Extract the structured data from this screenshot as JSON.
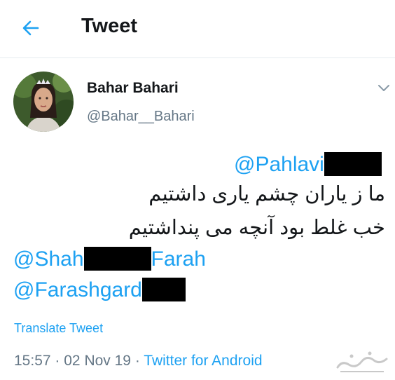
{
  "header": {
    "title": "Tweet"
  },
  "icons": {
    "back": "arrow-left-icon",
    "menu": "chevron-down-icon"
  },
  "author": {
    "display_name": "Bahar Bahari",
    "handle": "@Bahar__Bahari"
  },
  "tweet": {
    "mention1": "@Pahlavi",
    "line1": "ما ز یاران چشم یاری داشتیم",
    "line2": "خب غلط بود آنچه می پنداشتیم",
    "mention2_a": "@Shah",
    "mention2_b": "Farah",
    "mention3": "@Farashgard"
  },
  "translate_label": "Translate Tweet",
  "meta": {
    "time": "15:57",
    "date": "02 Nov 19",
    "source": "Twitter for Android",
    "separator": "·"
  },
  "colors": {
    "accent": "#1da1f2",
    "text": "#14171a",
    "secondary": "#657786"
  }
}
